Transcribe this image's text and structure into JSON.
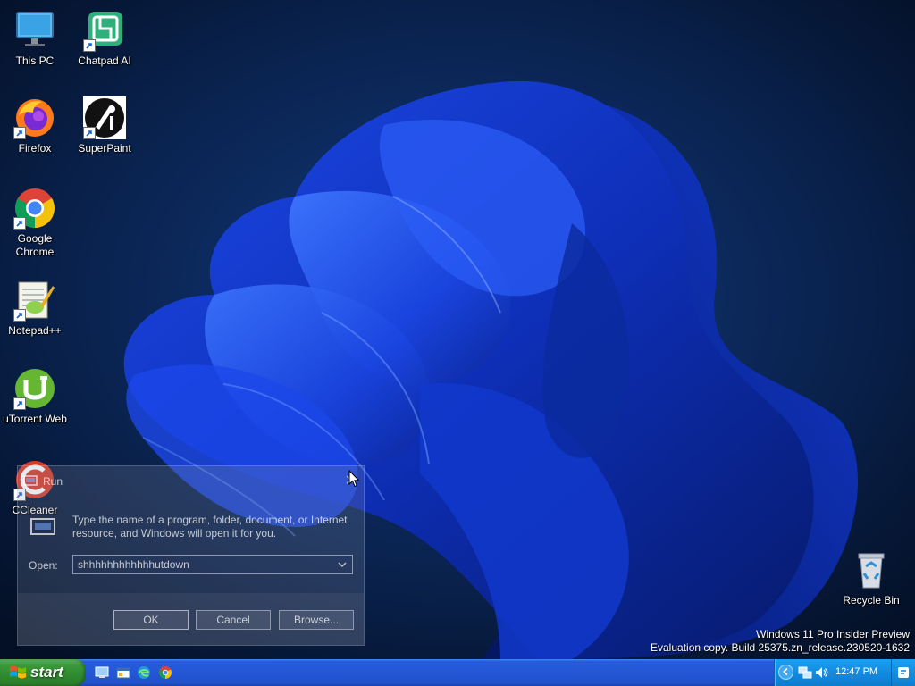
{
  "desktop": {
    "icons": [
      {
        "label": "This PC"
      },
      {
        "label": "Chatpad AI"
      },
      {
        "label": "Firefox"
      },
      {
        "label": "SuperPaint"
      },
      {
        "label": "Google Chrome"
      },
      {
        "label": "Notepad++"
      },
      {
        "label": "uTorrent Web"
      },
      {
        "label": "CCleaner"
      },
      {
        "label": "Recycle Bin"
      }
    ]
  },
  "watermark": {
    "line1": "Windows 11 Pro Insider Preview",
    "line2": "Evaluation copy. Build 25375.zn_release.230520-1632"
  },
  "run_dialog": {
    "title": "Run",
    "description": "Type the name of a program, folder, document, or Internet resource, and Windows will open it for you.",
    "open_label": "Open:",
    "open_value": "shhhhhhhhhhhhutdown",
    "ok_label": "OK",
    "cancel_label": "Cancel",
    "browse_label": "Browse..."
  },
  "taskbar": {
    "start_label": "start",
    "quick_launch": [
      "show-desktop-icon",
      "explorer-icon",
      "edge-icon",
      "chrome-icon"
    ],
    "clock": "12:47 PM"
  },
  "colors": {
    "taskbar_blue": "#245ddb",
    "start_green": "#3c9a3c",
    "tray_blue": "#138bdf"
  }
}
